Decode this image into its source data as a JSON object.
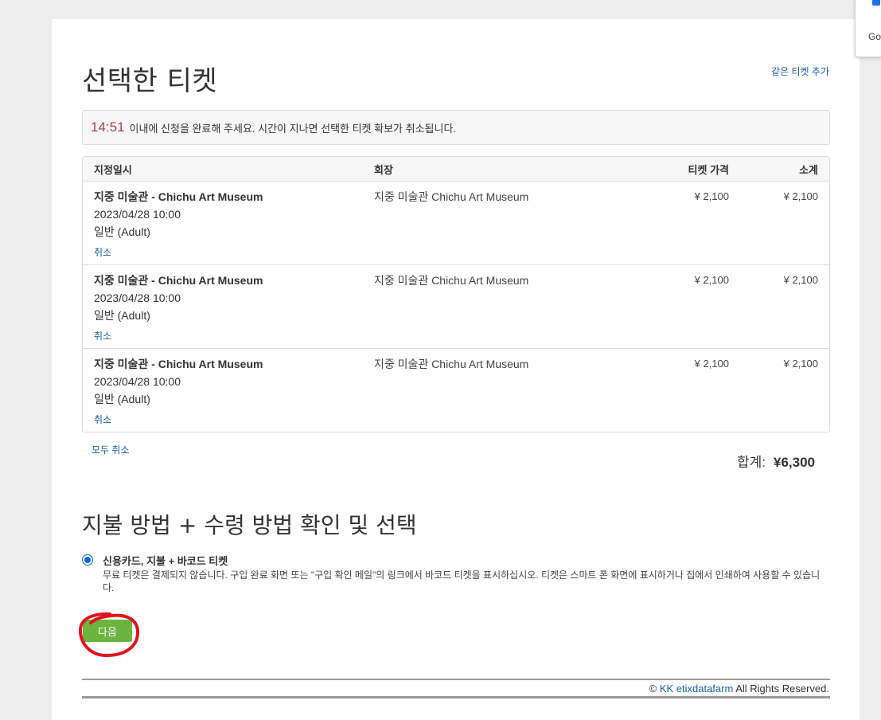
{
  "page": {
    "title": "선택한 티켓",
    "add_link": "같은 티켓 추가"
  },
  "timer": {
    "time": "14:51",
    "message": "이내에 신청을 완료해 주세요. 시간이 지나면 선택한 티켓 확보가 취소됩니다."
  },
  "table": {
    "headers": [
      "지정일시",
      "회장",
      "티켓 가격",
      "소계"
    ],
    "rows": [
      {
        "event": "지중 미술관 - Chichu Art Museum",
        "datetime": "2023/04/28 10:00",
        "type": "일반 (Adult)",
        "cancel": "취소",
        "venue": "지중 미술관 Chichu Art Museum",
        "price": "¥ 2,100",
        "subtotal": "¥ 2,100"
      },
      {
        "event": "지중 미술관 - Chichu Art Museum",
        "datetime": "2023/04/28 10:00",
        "type": "일반 (Adult)",
        "cancel": "취소",
        "venue": "지중 미술관 Chichu Art Museum",
        "price": "¥ 2,100",
        "subtotal": "¥ 2,100"
      },
      {
        "event": "지중 미술관 - Chichu Art Museum",
        "datetime": "2023/04/28 10:00",
        "type": "일반 (Adult)",
        "cancel": "취소",
        "venue": "지중 미술관 Chichu Art Museum",
        "price": "¥ 2,100",
        "subtotal": "¥ 2,100"
      }
    ]
  },
  "cancel_all": "모두 취소",
  "total": {
    "label": "합계:",
    "amount": "¥6,300"
  },
  "payment": {
    "title": "지불 방법 + 수령 방법 확인 및 선택",
    "option_title": "신용카드, 지불 + 바코드 티켓",
    "option_desc": "무료 티켓은 결제되지 않습니다. 구입 완료 화면 또는 \"구입 확인 메일\"의 링크에서 바코드 티켓을 표시하십시오. 티켓은 스마트 폰 화면에 표시하거나 집에서 인쇄하여 사용할 수 있습니다."
  },
  "next_button": "다음",
  "footer": {
    "copyright": "©",
    "brand": "KK etixdatafarm",
    "rights": "All Rights Reserved."
  },
  "popup": {
    "text": "Go"
  },
  "colors": {
    "link": "#1a5ea8",
    "timer": "#a94442",
    "button": "#6cb33f",
    "annotation": "#e0141e"
  }
}
